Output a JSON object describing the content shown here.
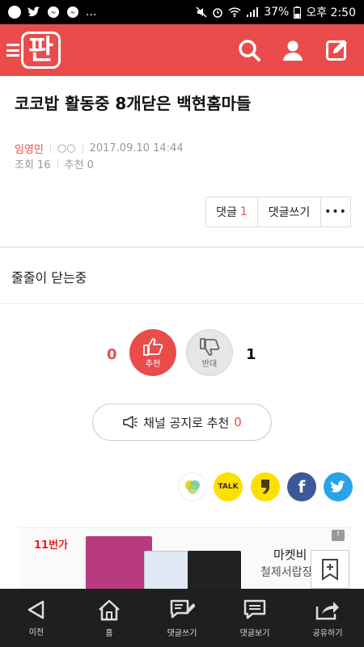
{
  "status_bar": {
    "battery": "37%",
    "time": "오후 2:50",
    "dots": "..."
  },
  "app_bar": {
    "logo": "판"
  },
  "post": {
    "title": "코코밥 활동중 8개닫은 백현홈마들",
    "author": "임영민",
    "masked": "○○",
    "date": "2017.09.10 14:44",
    "views": "조회 16",
    "recommends": "추천 0",
    "body": "줄줄이 닫는중"
  },
  "actions": {
    "comment_label": "댓글",
    "comment_count": "1",
    "write_comment_label": "댓글쓰기",
    "more": "•••"
  },
  "vote": {
    "up_count": "0",
    "up_label": "추천",
    "down_count": "1",
    "down_label": "반대"
  },
  "notice": {
    "label": "채널 공지로 추천",
    "count": "0"
  },
  "share": {
    "kakao_label": "TALK",
    "facebook": "f"
  },
  "ad": {
    "brand": "11번가",
    "title": "마켓비",
    "subtitle": "철제서랍장",
    "info": "!"
  },
  "bottom_nav": [
    {
      "label": "이전"
    },
    {
      "label": "홈"
    },
    {
      "label": "댓글쓰기"
    },
    {
      "label": "댓글보기"
    },
    {
      "label": "공유하기"
    }
  ]
}
